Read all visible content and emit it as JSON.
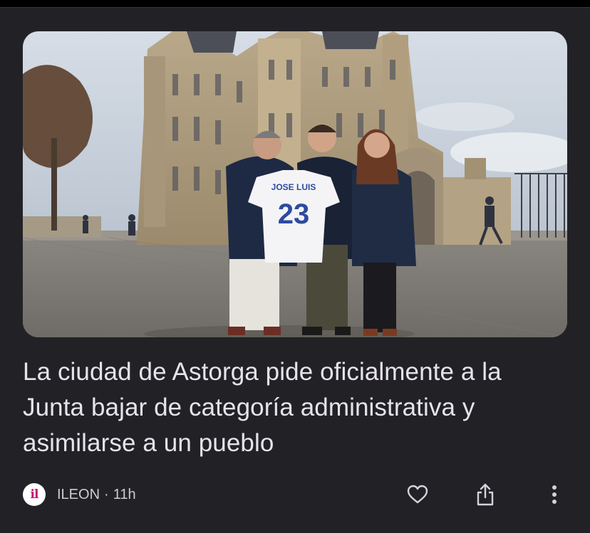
{
  "article": {
    "image_alt_icon": "news-photo",
    "shirt_name": "JOSE LUIS",
    "shirt_number": "23",
    "headline": "La ciudad de Astorga pide oficialmente a la Junta bajar de categoría administrativa y asimilarse a un pueblo"
  },
  "meta": {
    "source_logo": "il",
    "source_name": "ILEON",
    "separator": "·",
    "time_ago": "11h"
  },
  "actions": {
    "like_icon": "heart-outline-icon",
    "share_icon": "share-icon",
    "more_icon": "more-vert-icon"
  },
  "colors": {
    "background": "#222226",
    "text": "#e6e3ea",
    "meta_text": "#cfcbd3",
    "logo_accent": "#c2186e"
  }
}
